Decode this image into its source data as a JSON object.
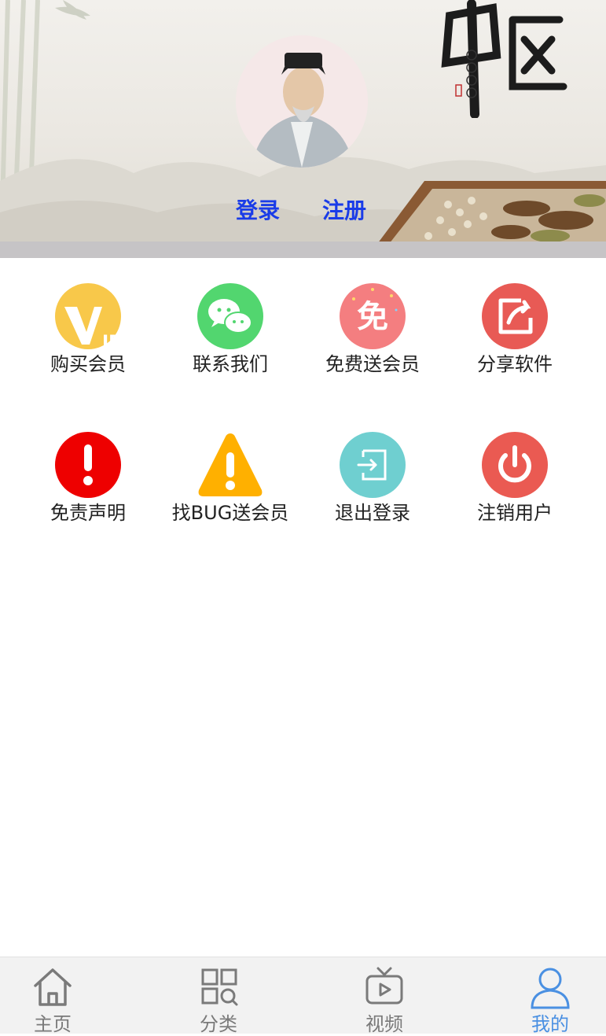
{
  "header": {
    "login_label": "登录",
    "register_label": "注册",
    "calligraphy_title": "中医"
  },
  "menu": {
    "items": [
      {
        "label": "购买会员",
        "icon": "vip-icon",
        "color": "#f8c84a"
      },
      {
        "label": "联系我们",
        "icon": "wechat-icon",
        "color": "#52d66f"
      },
      {
        "label": "免费送会员",
        "icon": "free-icon",
        "color": "#f47e80"
      },
      {
        "label": "分享软件",
        "icon": "share-icon",
        "color": "#e85a55"
      },
      {
        "label": "免责声明",
        "icon": "alert-circle-icon",
        "color": "#ee0000"
      },
      {
        "label": "找BUG送会员",
        "icon": "warning-triangle-icon",
        "color": "#ffb000"
      },
      {
        "label": "退出登录",
        "icon": "logout-icon",
        "color": "#6fcfd0"
      },
      {
        "label": "注销用户",
        "icon": "power-icon",
        "color": "#ea5a52"
      }
    ]
  },
  "tabbar": {
    "tabs": [
      {
        "label": "主页",
        "icon": "home-icon",
        "active": false
      },
      {
        "label": "分类",
        "icon": "category-icon",
        "active": false
      },
      {
        "label": "视频",
        "icon": "tv-icon",
        "active": false
      },
      {
        "label": "我的",
        "icon": "user-icon",
        "active": true
      }
    ],
    "active_color": "#4a90e2",
    "inactive_color": "#7a7a7a"
  }
}
